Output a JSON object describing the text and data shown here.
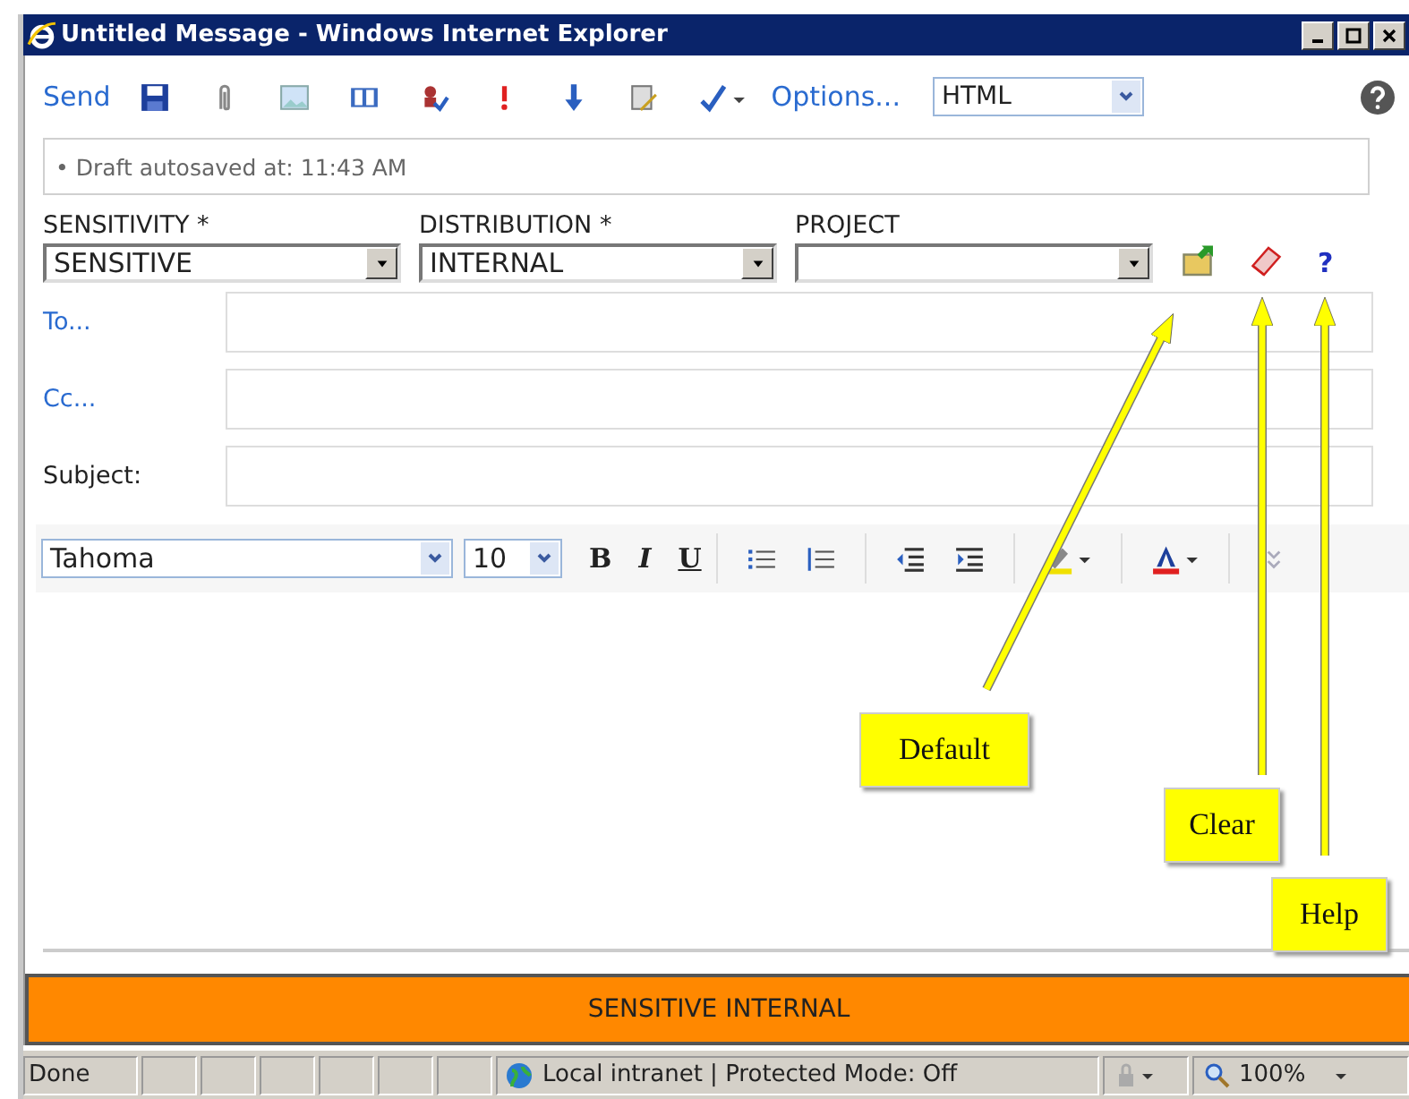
{
  "window": {
    "title": "Untitled Message - Windows Internet Explorer"
  },
  "toolbar": {
    "send": "Send",
    "options": "Options...",
    "format": "HTML"
  },
  "draft_note": "• Draft autosaved at: 11:43 AM",
  "classification": [
    {
      "label": "SENSITIVITY *",
      "value": "SENSITIVE"
    },
    {
      "label": "DISTRIBUTION *",
      "value": "INTERNAL"
    },
    {
      "label": "PROJECT"
    }
  ],
  "help_mark": "?",
  "address_rows": [
    {
      "label": "To...",
      "kind": "link"
    },
    {
      "label": "Cc...",
      "kind": "link"
    },
    {
      "label": "Subject:",
      "kind": "plain"
    }
  ],
  "format_bar": {
    "font": "Tahoma",
    "size": "10",
    "styles": [
      "B",
      "I",
      "U"
    ]
  },
  "banner": "SENSITIVE INTERNAL",
  "status_bar": {
    "status": "Done",
    "zone": "Local intranet | Protected Mode: Off",
    "zoom": "100%"
  },
  "callouts": [
    "Default",
    "Clear",
    "Help"
  ]
}
